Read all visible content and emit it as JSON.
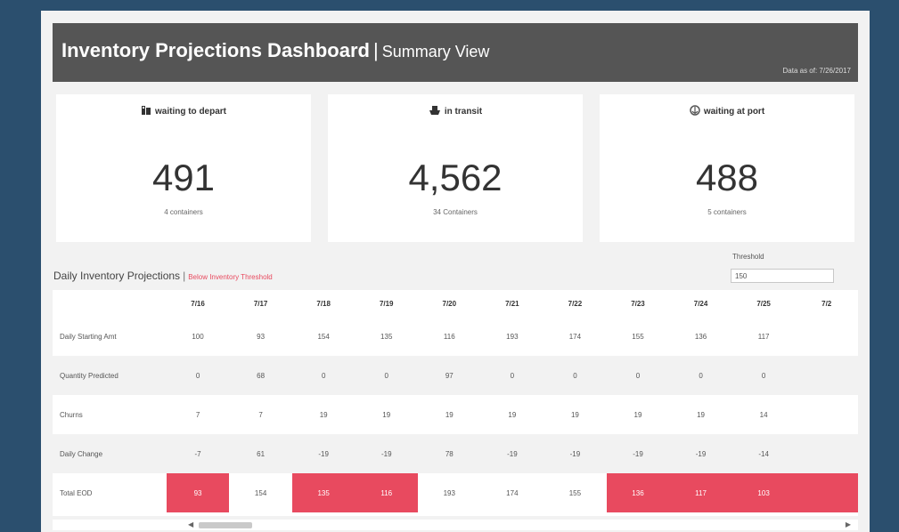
{
  "header": {
    "title": "Inventory Projections Dashboard",
    "separator": "|",
    "subtitle": "Summary View",
    "as_of": "Data as of: 7/26/2017"
  },
  "cards": [
    {
      "icon": "depot-icon",
      "label": "waiting to depart",
      "value": "491",
      "sub": "4 containers"
    },
    {
      "icon": "ship-icon",
      "label": "in transit",
      "value": "4,562",
      "sub": "34 Containers"
    },
    {
      "icon": "port-icon",
      "label": "waiting at port",
      "value": "488",
      "sub": "5 containers"
    }
  ],
  "projections": {
    "title": "Daily Inventory Projections",
    "separator": "|",
    "legend": "Below Inventory Threshold",
    "threshold_label": "Threshold",
    "threshold_value": "150"
  },
  "table": {
    "dates": [
      "7/16",
      "7/17",
      "7/18",
      "7/19",
      "7/20",
      "7/21",
      "7/22",
      "7/23",
      "7/24",
      "7/25",
      "7/2"
    ],
    "rows": [
      {
        "label": "Daily Starting Amt",
        "values": [
          "100",
          "93",
          "154",
          "135",
          "116",
          "193",
          "174",
          "155",
          "136",
          "117",
          ""
        ],
        "below": []
      },
      {
        "label": "Quantity Predicted",
        "values": [
          "0",
          "68",
          "0",
          "0",
          "97",
          "0",
          "0",
          "0",
          "0",
          "0",
          ""
        ],
        "below": []
      },
      {
        "label": "Churns",
        "values": [
          "7",
          "7",
          "19",
          "19",
          "19",
          "19",
          "19",
          "19",
          "19",
          "14",
          ""
        ],
        "below": []
      },
      {
        "label": "Daily Change",
        "values": [
          "-7",
          "61",
          "-19",
          "-19",
          "78",
          "-19",
          "-19",
          "-19",
          "-19",
          "-14",
          ""
        ],
        "below": []
      },
      {
        "label": "Total EOD",
        "values": [
          "93",
          "154",
          "135",
          "116",
          "193",
          "174",
          "155",
          "136",
          "117",
          "103",
          ""
        ],
        "below": [
          0,
          2,
          3,
          7,
          8,
          9,
          10
        ]
      }
    ]
  },
  "colors": {
    "background": "#2b4f6e",
    "header": "#555555",
    "alert": "#e84a5f"
  }
}
